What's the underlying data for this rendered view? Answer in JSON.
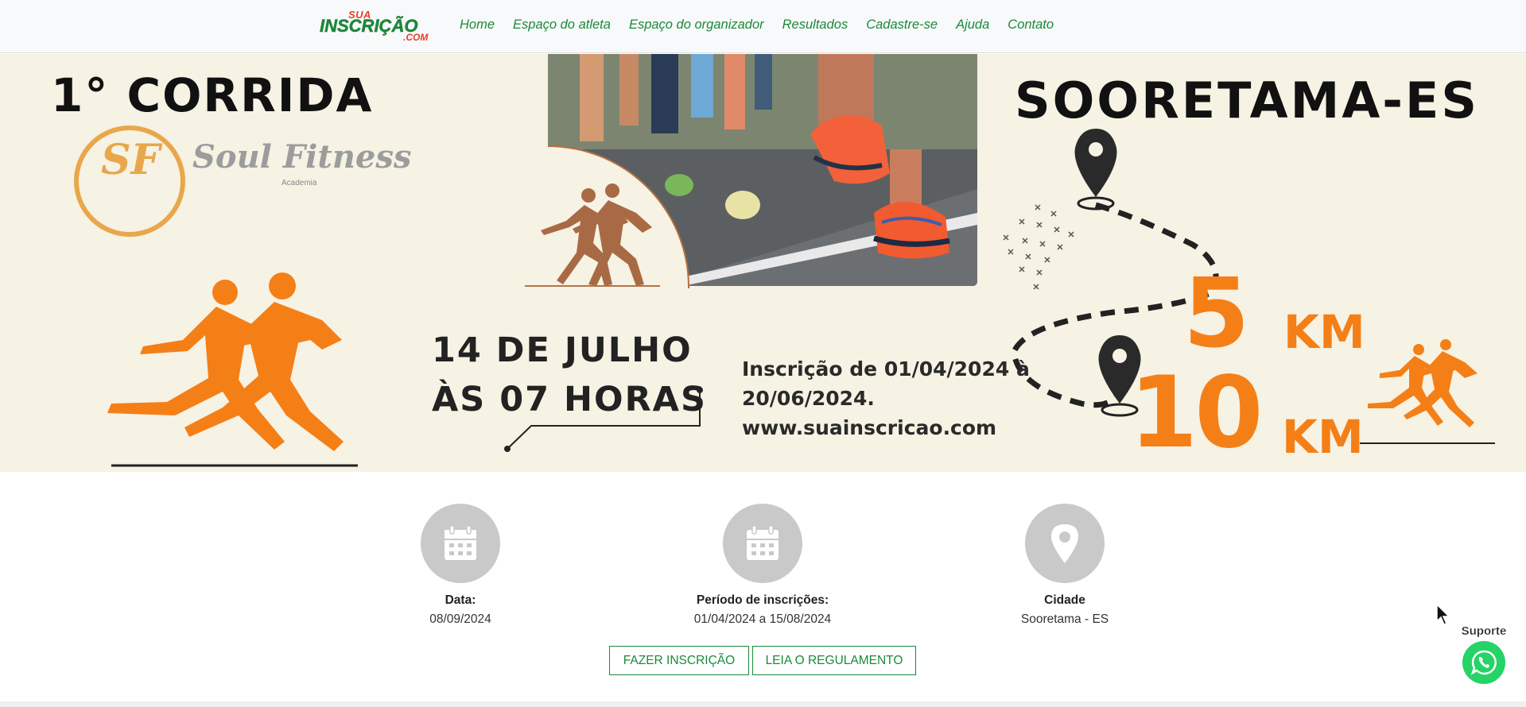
{
  "navbar": {
    "logo": {
      "top": "SUA",
      "main": "INSCRIÇÃO",
      "suffix": ".COM"
    },
    "links": [
      "Home",
      "Espaço do atleta",
      "Espaço do organizador",
      "Resultados",
      "Cadastre-se",
      "Ajuda",
      "Contato"
    ]
  },
  "banner": {
    "title_left": "1° CORRIDA",
    "title_right": "SOORETAMA-ES",
    "sponsor_name": "Soul Fitness",
    "sponsor_sub": "Academia",
    "sponsor_initials": "SF",
    "date_line1": "14 DE JULHO",
    "date_line2": "ÀS 07 HORAS",
    "insc_line1": "Inscrição de 01/04/2024 à",
    "insc_line2": "20/06/2024.",
    "insc_line3": "www.suainscricao.com",
    "dist1_num": "5",
    "dist1_unit": "KM",
    "dist2_num": "10",
    "dist2_unit": "KM"
  },
  "info": {
    "date_label": "Data:",
    "date_value": "08/09/2024",
    "period_label": "Período de inscrições:",
    "period_value": "01/04/2024 a 15/08/2024",
    "city_label": "Cidade",
    "city_value": "Sooretama - ES"
  },
  "buttons": {
    "register": "FAZER INSCRIÇÃO",
    "rules": "LEIA O REGULAMENTO"
  },
  "support": {
    "label": "Suporte"
  },
  "colors": {
    "brand_green": "#1a8a3a",
    "orange": "#f57f17",
    "banner_bg": "#f6f2e4"
  }
}
